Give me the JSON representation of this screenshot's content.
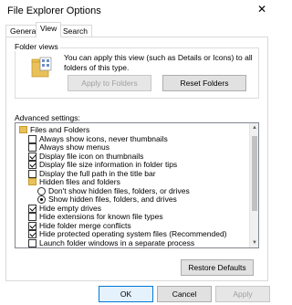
{
  "window": {
    "title": "File Explorer Options",
    "close_glyph": "✕"
  },
  "tabs": [
    {
      "label": "General",
      "active": false
    },
    {
      "label": "View",
      "active": true
    },
    {
      "label": "Search",
      "active": false
    }
  ],
  "folder_views": {
    "title": "Folder views",
    "description": "You can apply this view (such as Details or Icons) to all folders of this type.",
    "apply_button": "Apply to Folders",
    "reset_button": "Reset Folders"
  },
  "advanced": {
    "label": "Advanced settings:",
    "items": [
      {
        "type": "folder",
        "level": 0,
        "label": "Files and Folders"
      },
      {
        "type": "check",
        "level": 1,
        "checked": false,
        "label": "Always show icons, never thumbnails"
      },
      {
        "type": "check",
        "level": 1,
        "checked": false,
        "label": "Always show menus"
      },
      {
        "type": "check",
        "level": 1,
        "checked": true,
        "label": "Display file icon on thumbnails"
      },
      {
        "type": "check",
        "level": 1,
        "checked": true,
        "label": "Display file size information in folder tips"
      },
      {
        "type": "check",
        "level": 1,
        "checked": false,
        "label": "Display the full path in the title bar"
      },
      {
        "type": "folder",
        "level": 1,
        "label": "Hidden files and folders"
      },
      {
        "type": "radio",
        "level": 2,
        "checked": false,
        "label": "Don't show hidden files, folders, or drives"
      },
      {
        "type": "radio",
        "level": 2,
        "checked": true,
        "label": "Show hidden files, folders, and drives"
      },
      {
        "type": "check",
        "level": 1,
        "checked": true,
        "label": "Hide empty drives"
      },
      {
        "type": "check",
        "level": 1,
        "checked": false,
        "label": "Hide extensions for known file types"
      },
      {
        "type": "check",
        "level": 1,
        "checked": true,
        "label": "Hide folder merge conflicts"
      },
      {
        "type": "check",
        "level": 1,
        "checked": true,
        "label": "Hide protected operating system files (Recommended)"
      },
      {
        "type": "check",
        "level": 1,
        "checked": false,
        "label": "Launch folder windows in a separate process"
      }
    ],
    "restore_button": "Restore Defaults"
  },
  "footer": {
    "ok": "OK",
    "cancel": "Cancel",
    "apply": "Apply"
  },
  "colors": {
    "accent": "#0078d7",
    "folder": "#e8c15a"
  }
}
